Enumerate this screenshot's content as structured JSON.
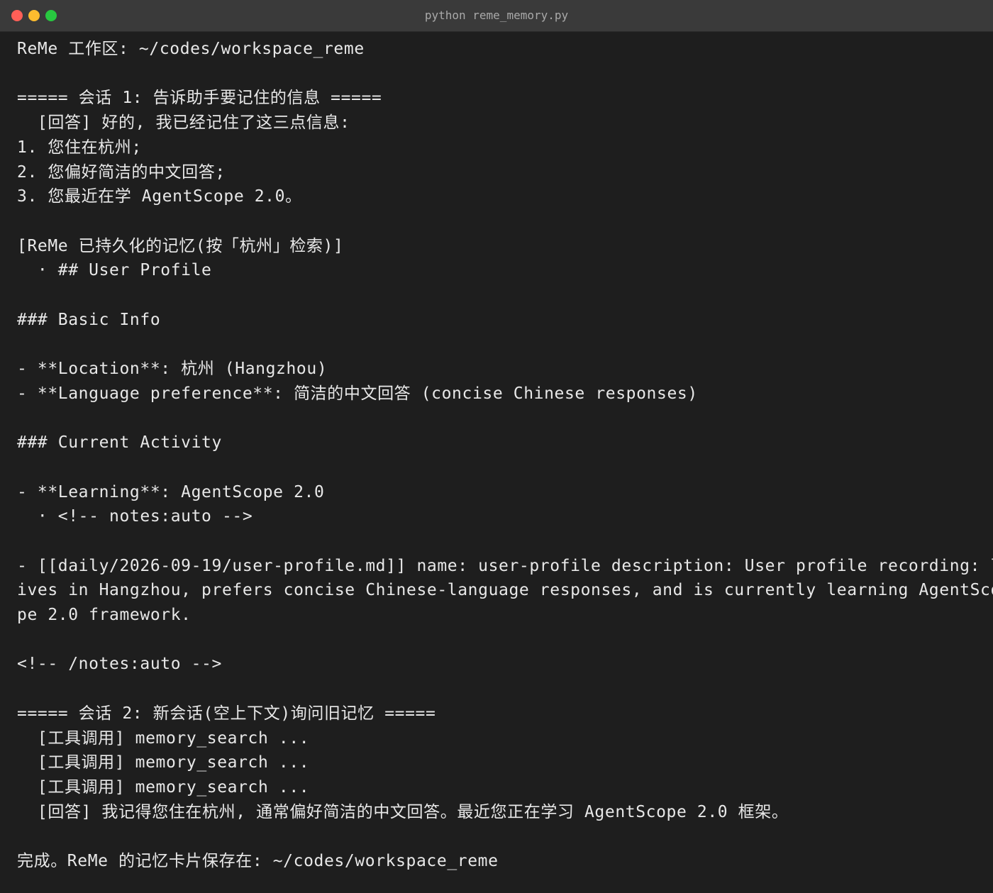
{
  "window": {
    "title": "python reme_memory.py"
  },
  "terminal": {
    "lines": [
      "ReMe 工作区: ~/codes/workspace_reme",
      "",
      "===== 会话 1: 告诉助手要记住的信息 =====",
      "  [回答] 好的, 我已经记住了这三点信息:",
      "1. 您住在杭州;",
      "2. 您偏好简洁的中文回答;",
      "3. 您最近在学 AgentScope 2.0。",
      "",
      "[ReMe 已持久化的记忆(按「杭州」检索)]",
      "  · ## User Profile",
      "",
      "### Basic Info",
      "",
      "- **Location**: 杭州 (Hangzhou)",
      "- **Language preference**: 简洁的中文回答 (concise Chinese responses)",
      "",
      "### Current Activity",
      "",
      "- **Learning**: AgentScope 2.0",
      "  · <!-- notes:auto -->",
      "",
      "- [[daily/2026-09-19/user-profile.md]] name: user-profile description: User profile recording: l",
      "ives in Hangzhou, prefers concise Chinese-language responses, and is currently learning AgentSco",
      "pe 2.0 framework.",
      "",
      "<!-- /notes:auto -->",
      "",
      "===== 会话 2: 新会话(空上下文)询问旧记忆 =====",
      "  [工具调用] memory_search ...",
      "  [工具调用] memory_search ...",
      "  [工具调用] memory_search ...",
      "  [回答] 我记得您住在杭州, 通常偏好简洁的中文回答。最近您正在学习 AgentScope 2.0 框架。",
      "",
      "完成。ReMe 的记忆卡片保存在: ~/codes/workspace_reme"
    ]
  },
  "colors": {
    "background": "#1e1e1e",
    "titlebar": "#3a3a3a",
    "text": "#e8e8e8",
    "title_text": "#a9a9a9",
    "close": "#ff5f57",
    "minimize": "#febc2e",
    "maximize": "#28c840"
  }
}
